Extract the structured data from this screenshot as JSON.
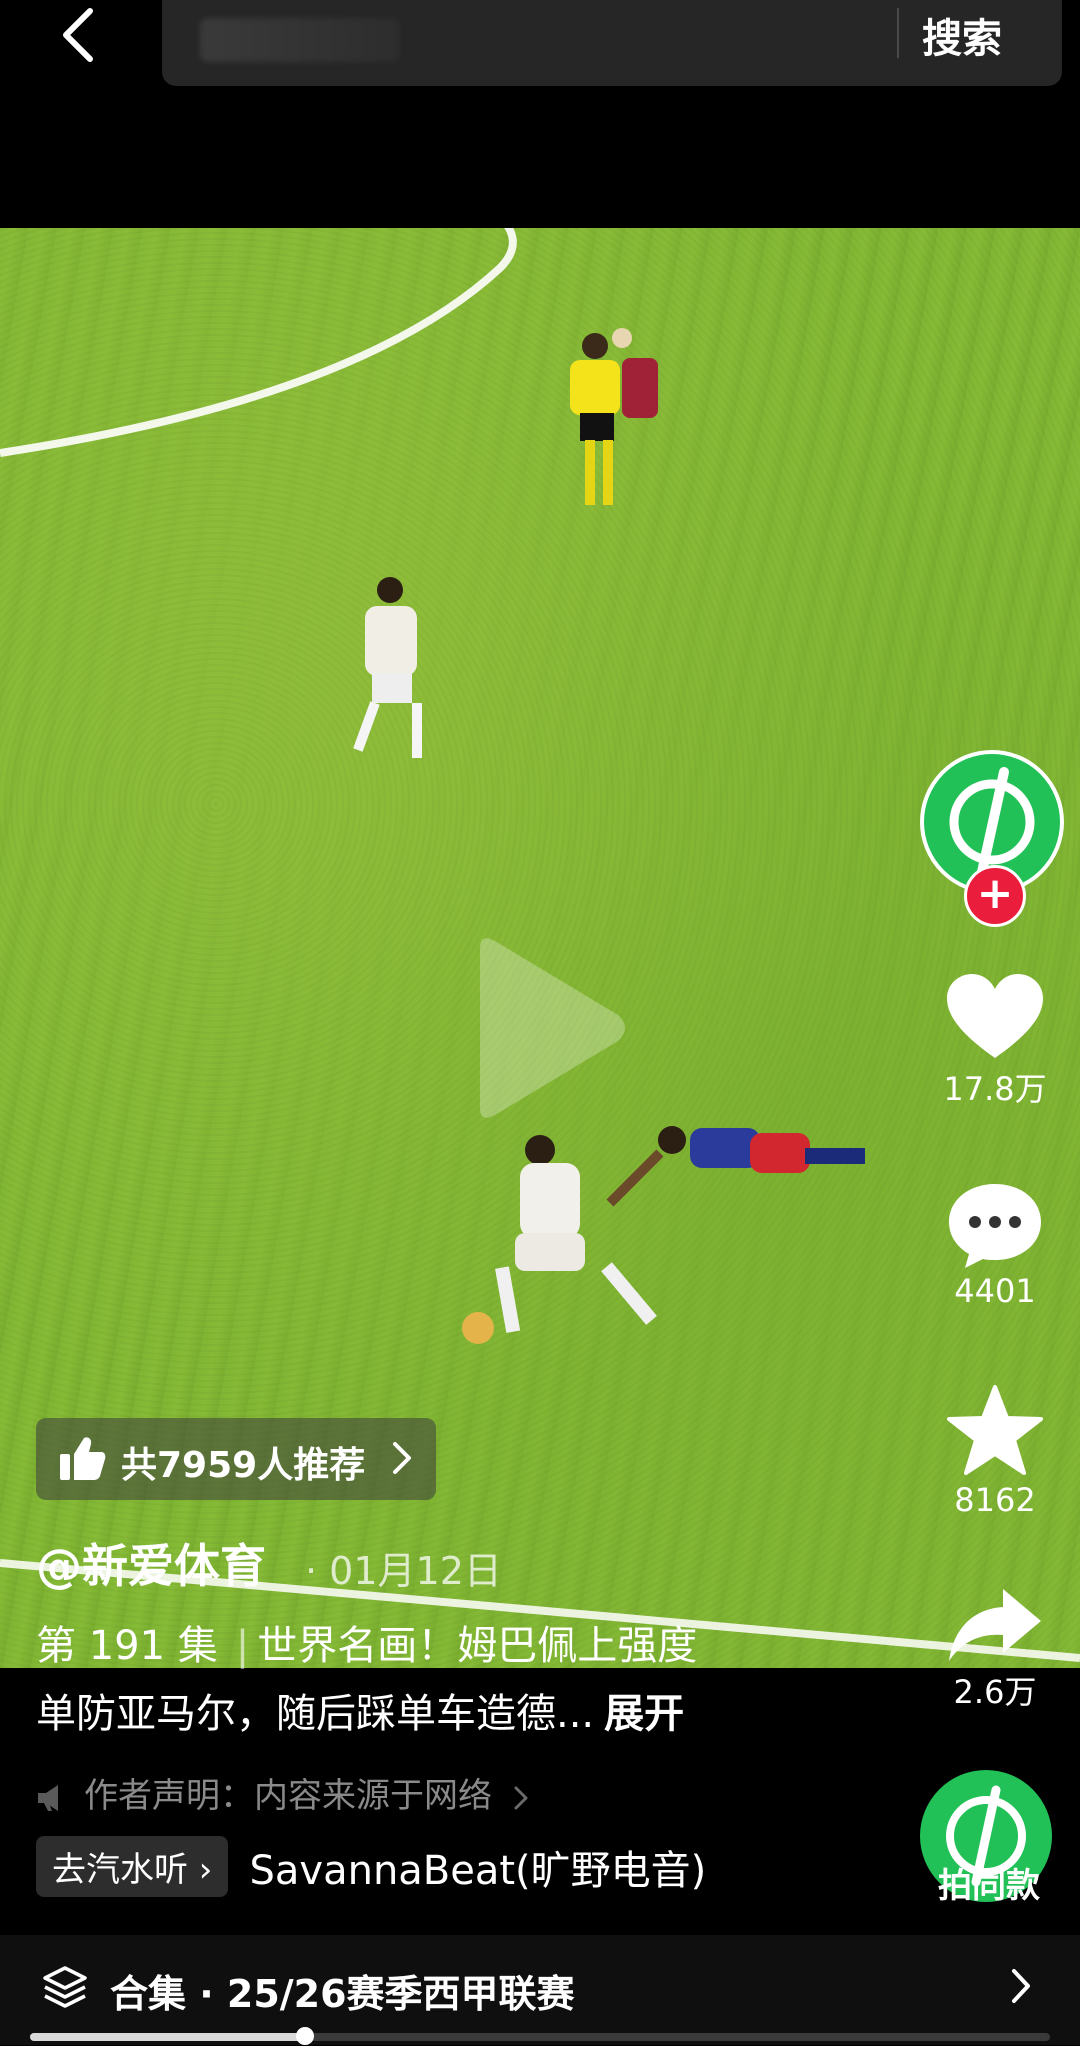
{
  "search": {
    "placeholder": "",
    "button_label": "搜索"
  },
  "video": {
    "state": "paused"
  },
  "sidebar": {
    "likes": "17.8万",
    "comments": "4401",
    "favorites": "8162",
    "shares": "2.6万"
  },
  "overlay": {
    "recommend_text": "共7959人推荐",
    "author": "@新爱体育",
    "date": "· 01月12日",
    "episode": "第 191 集",
    "desc_line1": "世界名画！姆巴佩上强度",
    "desc_line2": "单防亚马尔，随后踩单车造德...",
    "expand_label": "展开",
    "statement": "作者声明：内容来源于网络",
    "music_tag": "去汽水听 ›",
    "music_name": "SavannaBeat(旷野电音)",
    "same_style_label": "拍同款"
  },
  "collection": {
    "label": "合集 · 25/26赛季西甲联赛"
  },
  "colors": {
    "accent_green": "#22c157",
    "follow_red": "#ea1d3c",
    "background": "#000000"
  },
  "progress": {
    "fraction": 0.27
  }
}
